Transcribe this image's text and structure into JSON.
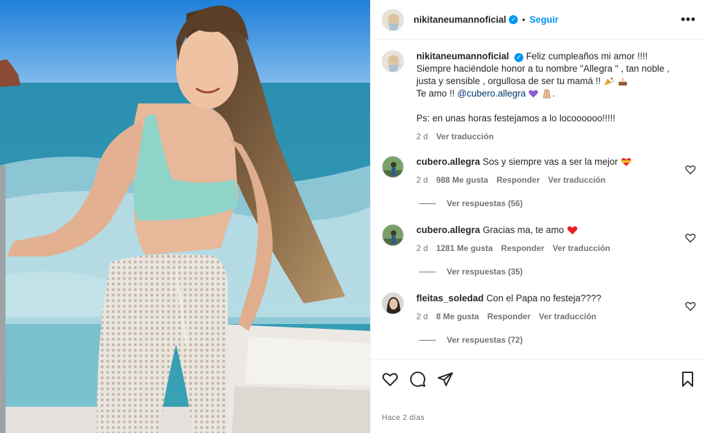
{
  "post": {
    "username": "nikitaneumannoficial",
    "follow_label": "Seguir",
    "separator": "•",
    "more_label": "•••",
    "time_ago": "Hace 2 días"
  },
  "caption": {
    "username": "nikitaneumannoficial",
    "line1": "Feliz cumpleaños mi amor !!!!",
    "line2": "Siempre haciéndole honor a tu nombre \"Allegra \" , tan noble ,",
    "line3": "justa y sensible , orgullosa de ser tu mamá !!",
    "line4_prefix": "Te amo !! ",
    "line4_mention": "@cubero.allegra",
    "line5": "Ps: en unas horas festejamos a lo locoooooo!!!!!",
    "age": "2 d",
    "translate_label": "Ver traducción"
  },
  "comments": [
    {
      "username": "cubero.allegra",
      "text": "Sos y siempre vas a ser la mejor",
      "age": "2 d",
      "likes": "988 Me gusta",
      "reply_label": "Responder",
      "translate_label": "Ver traducción",
      "replies_label": "Ver respuestas (56)"
    },
    {
      "username": "cubero.allegra",
      "text": "Gracias ma, te amo",
      "age": "2 d",
      "likes": "1281 Me gusta",
      "reply_label": "Responder",
      "translate_label": "Ver traducción",
      "replies_label": "Ver respuestas (35)"
    },
    {
      "username": "fleitas_soledad",
      "text": "Con el Papa no festeja????",
      "age": "2 d",
      "likes": "8 Me gusta",
      "reply_label": "Responder",
      "translate_label": "Ver traducción",
      "replies_label": "Ver respuestas (72)"
    }
  ],
  "icons": {
    "like": "heart-icon",
    "comment": "comment-bubble-icon",
    "share": "paper-plane-icon",
    "save": "bookmark-icon",
    "verified": "verified-badge-icon",
    "more": "ellipsis-icon"
  },
  "colors": {
    "link_blue": "#0095f6",
    "mention": "#00376b",
    "muted": "#737373",
    "heart_red": "#ed1c24"
  }
}
